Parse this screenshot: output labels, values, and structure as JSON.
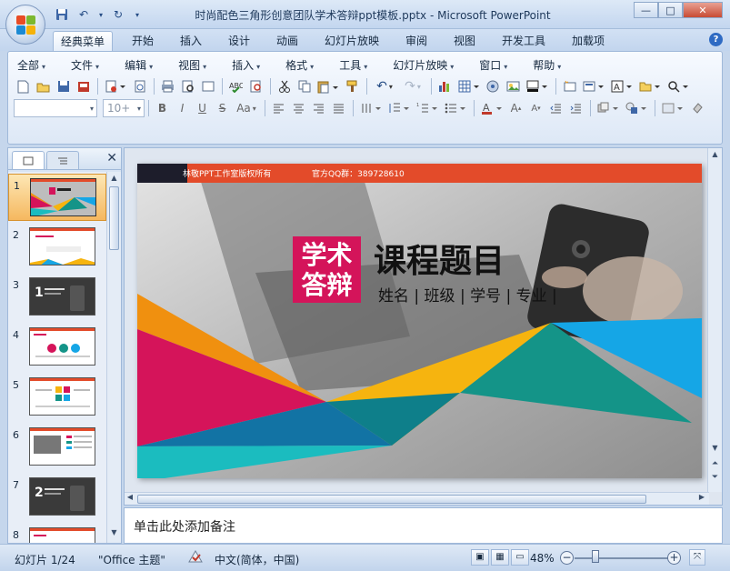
{
  "window": {
    "title": "时尚配色三角形创意团队学术答辩ppt模板.pptx - Microsoft PowerPoint",
    "minimize": "—",
    "maximize": "□",
    "close": "✕"
  },
  "ribbon_tabs": [
    "经典菜单",
    "开始",
    "插入",
    "设计",
    "动画",
    "幻灯片放映",
    "审阅",
    "视图",
    "开发工具",
    "加载项"
  ],
  "active_tab": "经典菜单",
  "classic_menu": [
    "全部",
    "文件",
    "编辑",
    "视图",
    "插入",
    "格式",
    "工具",
    "幻灯片放映",
    "窗口",
    "帮助"
  ],
  "font_box": {
    "font_name": "",
    "font_size": "10+"
  },
  "thumbnail_numbers": [
    "1",
    "2",
    "3",
    "4",
    "5",
    "6",
    "7",
    "8"
  ],
  "slide": {
    "banner_left": "林敬PPT工作室版权所有",
    "banner_right": "官方QQ群：389728610",
    "badge_line1": "学术",
    "badge_line2": "答辩",
    "title": "课程题目",
    "subtitle": "姓名 | 班级 | 学号 | 专业 |",
    "colors": {
      "banner": "#e34b2a",
      "badge": "#d4145a",
      "orange": "#f0900f",
      "magenta": "#d5145a",
      "yellow": "#f6b40f",
      "teal": "#149488",
      "blue": "#15a6e6",
      "cyan": "#1bbcbf",
      "navy": "#1273a4"
    }
  },
  "notes_placeholder": "单击此处添加备注",
  "status": {
    "slide_count": "幻灯片 1/24",
    "theme": "\"Office 主题\"",
    "language": "中文(简体，中国)",
    "zoom": "48%",
    "zoom_level": 48
  }
}
